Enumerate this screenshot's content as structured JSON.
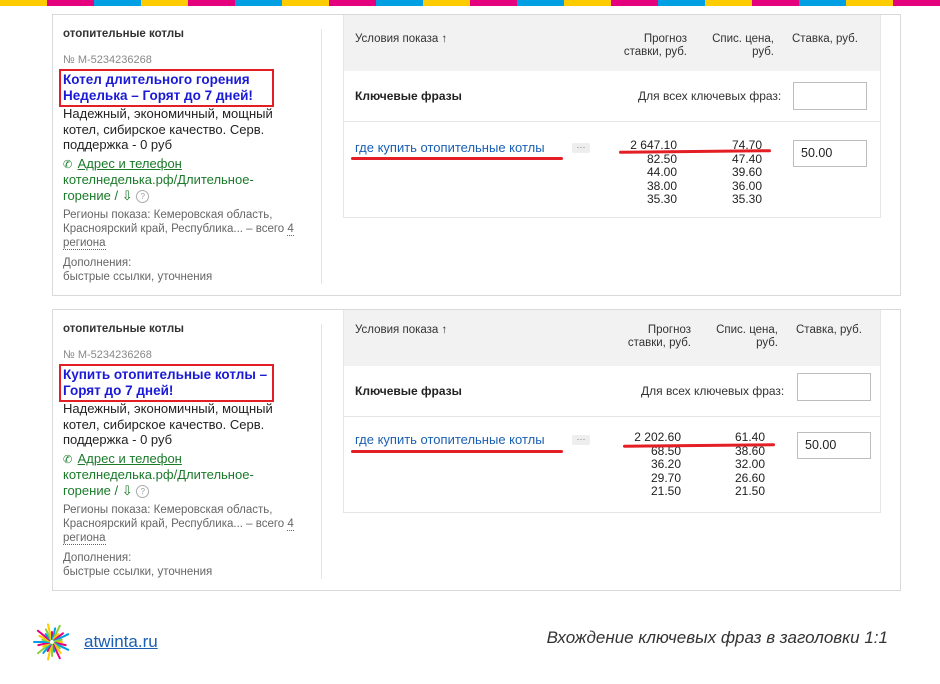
{
  "colors": {
    "stripe": [
      "#ffcc00",
      "#e5007e",
      "#00a0e3",
      "#ffcc00",
      "#e5007e",
      "#00a0e3",
      "#ffcc00",
      "#e5007e",
      "#00a0e3",
      "#ffcc00",
      "#e5007e",
      "#00a0e3",
      "#ffcc00",
      "#e5007e",
      "#00a0e3",
      "#ffcc00",
      "#e5007e",
      "#00a0e3",
      "#ffcc00",
      "#e5007e"
    ],
    "highlight": "#e31e24",
    "title_link": "#1a1ad6",
    "green": "#1a7a2a",
    "link": "#1a5fb4"
  },
  "ads": [
    {
      "category": "отопительные котлы",
      "id": "№ М-5234236268",
      "title": "Котел длительного горения Неделька – Горят до 7 дней!",
      "description": "Надежный, экономичный, мощный котел, сибирское качество. Серв. поддержка - 0 руб",
      "address_link": "Адрес и телефон",
      "url": "котелнеделька.рф/Длительное-горение",
      "regions_label": "Регионы показа: Кемеровская область, Красноярский край, Республика... – всего",
      "regions_count": "4 региона",
      "extras_label": "Дополнения:",
      "extras_value": "быстрые ссылки, уточнения",
      "table": {
        "col_conditions": "Условия показа",
        "col_forecast": "Прогноз ставки, руб.",
        "col_price": "Спис. цена, руб.",
        "col_bid": "Ставка, руб.",
        "keywords_label": "Ключевые фразы",
        "all_keywords_label": "Для всех ключевых фраз:",
        "all_keywords_value": "",
        "phrase": "где купить отопительные котлы",
        "forecast": [
          "2 647.10",
          "82.50",
          "44.00",
          "38.00",
          "35.30"
        ],
        "price": [
          "74.70",
          "47.40",
          "39.60",
          "36.00",
          "35.30"
        ],
        "bid": "50.00"
      }
    },
    {
      "category": "отопительные котлы",
      "id": "№ М-5234236268",
      "title": "Купить отопительные котлы – Горят до 7 дней!",
      "description": "Надежный, экономичный, мощный котел, сибирское качество. Серв. поддержка - 0 руб",
      "address_link": "Адрес и телефон",
      "url": "котелнеделька.рф/Длительное-горение",
      "regions_label": "Регионы показа: Кемеровская область, Красноярский край, Республика... – всего",
      "regions_count": "4 региона",
      "extras_label": "Дополнения:",
      "extras_value": "быстрые ссылки, уточнения",
      "table": {
        "col_conditions": "Условия показа",
        "col_forecast": "Прогноз ставки, руб.",
        "col_price": "Спис. цена, руб.",
        "col_bid": "Ставка, руб.",
        "keywords_label": "Ключевые фразы",
        "all_keywords_label": "Для всех ключевых фраз:",
        "all_keywords_value": "",
        "phrase": "где купить отопительные котлы",
        "forecast": [
          "2 202.60",
          "68.50",
          "36.20",
          "29.70",
          "21.50"
        ],
        "price": [
          "61.40",
          "38.60",
          "32.00",
          "26.60",
          "21.50"
        ],
        "bid": "50.00"
      }
    }
  ],
  "footer": {
    "brand": "atwinta.ru",
    "caption": "Вхождение ключевых фраз в заголовки 1:1"
  }
}
